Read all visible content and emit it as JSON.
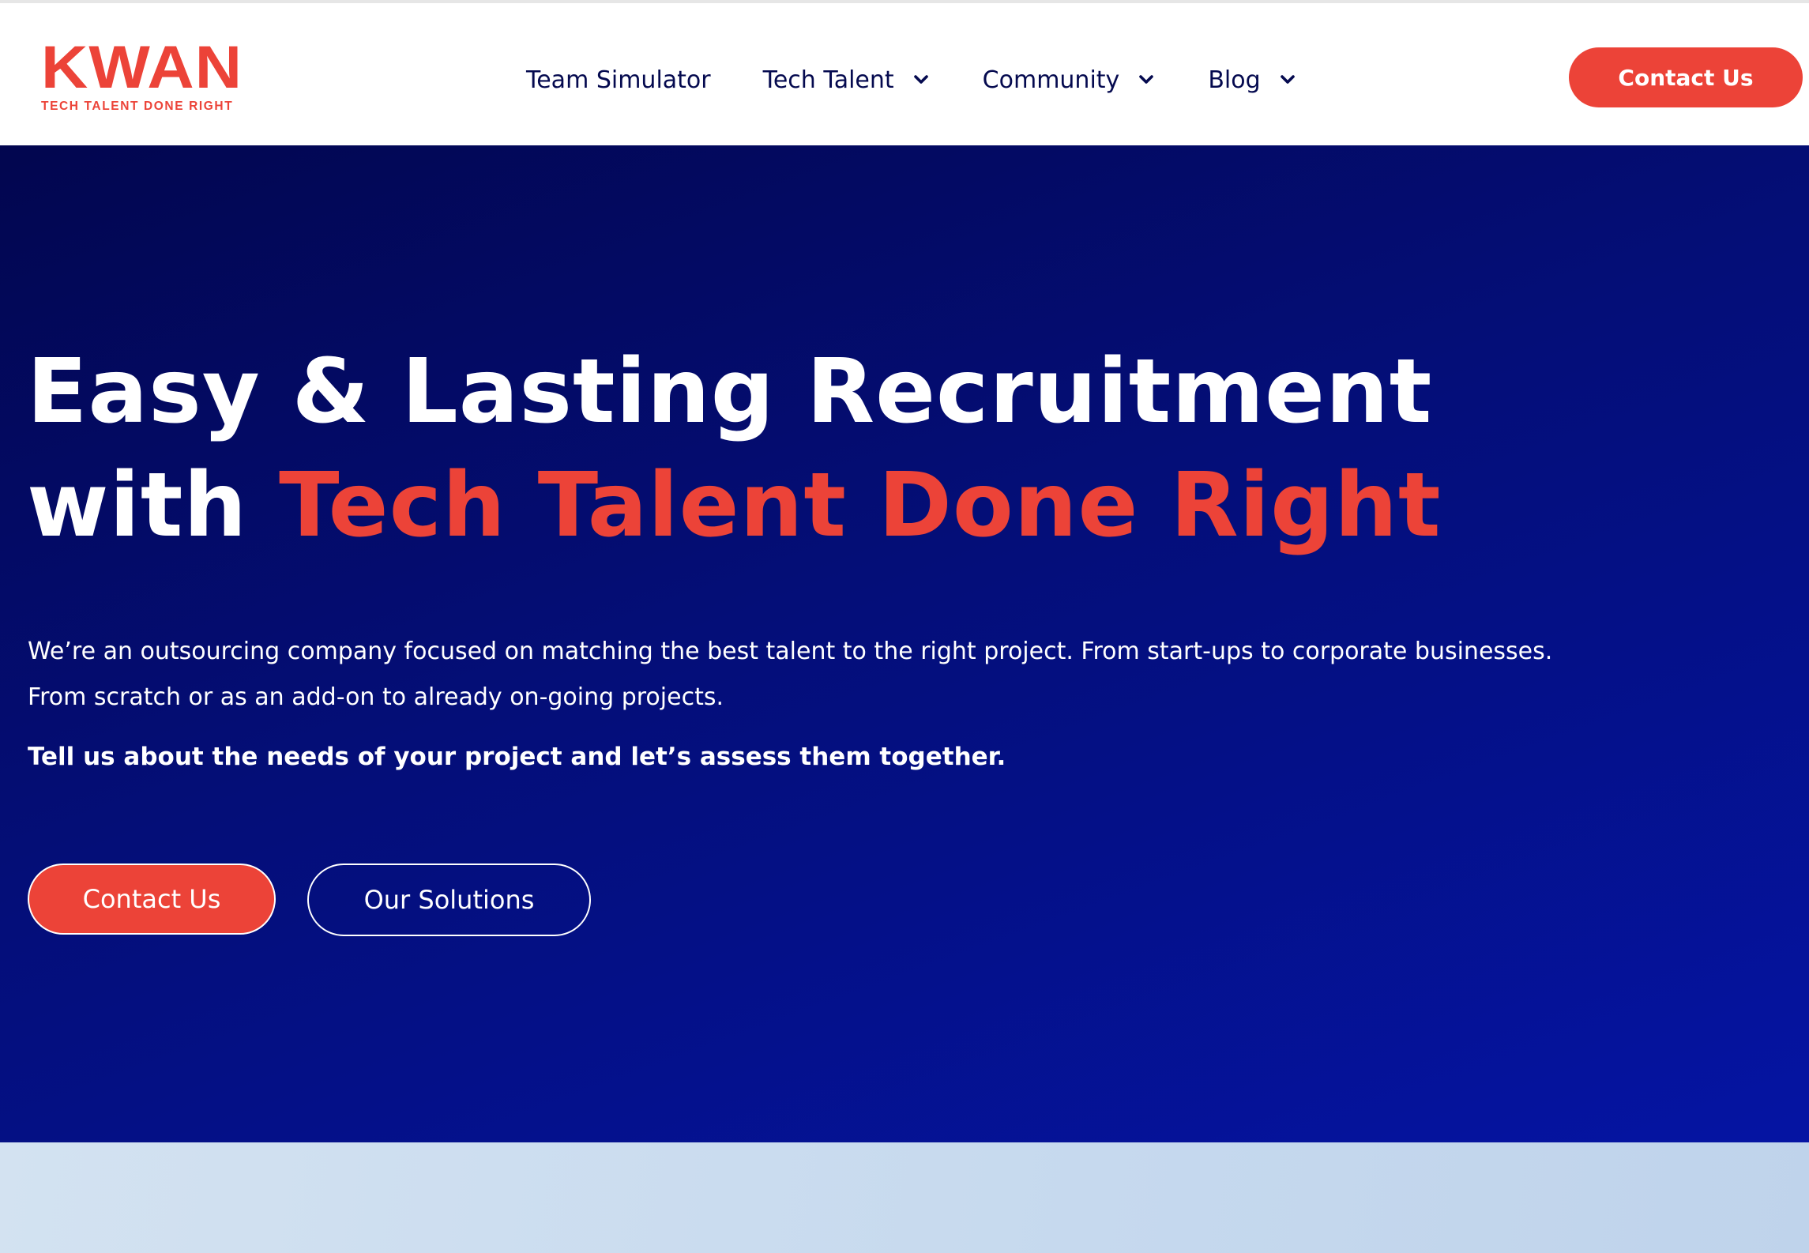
{
  "header": {
    "logo": {
      "wordmark": "KWAN",
      "tagline": "TECH TALENT DONE RIGHT"
    },
    "nav": [
      {
        "label": "Team Simulator",
        "has_dropdown": false
      },
      {
        "label": "Tech Talent",
        "has_dropdown": true,
        "icon": "chevron-down-icon"
      },
      {
        "label": "Community",
        "has_dropdown": true,
        "icon": "chevron-down-icon"
      },
      {
        "label": "Blog",
        "has_dropdown": true,
        "icon": "chevron-down-icon"
      }
    ],
    "cta_label": "Contact Us"
  },
  "hero": {
    "title_line1": "Easy & Lasting Recruitment",
    "title_line2_prefix": "with ",
    "title_line2_accent": "Tech Talent Done Right",
    "description_line1": "We’re an outsourcing company focused on matching the best talent to the right project. From start-ups to corporate businesses.",
    "description_line2": "From scratch or as an add-on to already on-going projects.",
    "strong_text": "Tell us about the needs of your project and let’s assess them together.",
    "primary_button": "Contact Us",
    "secondary_button": "Our Solutions"
  },
  "colors": {
    "brand_red": "#ec4338",
    "navy_text": "#050a4f",
    "hero_gradient_start": "#02064f",
    "hero_gradient_end": "#0514a3",
    "next_section_bg": "#cddff0"
  }
}
